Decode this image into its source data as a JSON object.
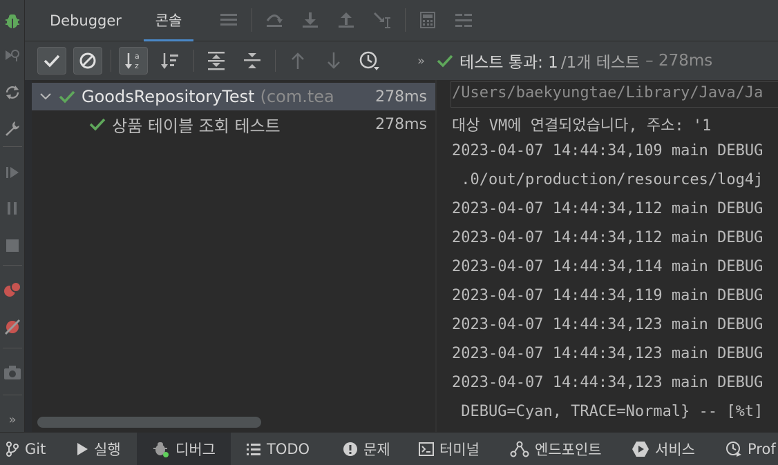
{
  "top_tabs": {
    "debugger": "Debugger",
    "console": "콘솔"
  },
  "test_status": {
    "label": "테스트 통과: 1",
    "suffix": "/1개 테스트",
    "duration": "– 278ms"
  },
  "tree": {
    "root": {
      "name": "GoodsRepositoryTest",
      "package": "(com.tea",
      "time": "278ms"
    },
    "child": {
      "name": "상품 테이블 조회 테스트",
      "time": "278ms"
    }
  },
  "console_lines": [
    "/Users/baekyungtae/Library/Java/Ja",
    "대상 VM에 연결되었습니다, 주소: '1",
    "2023-04-07 14:44:34,109 main DEBUG",
    " .0/out/production/resources/log4j",
    "2023-04-07 14:44:34,112 main DEBUG",
    "2023-04-07 14:44:34,112 main DEBUG",
    "2023-04-07 14:44:34,114 main DEBUG",
    "2023-04-07 14:44:34,119 main DEBUG",
    "2023-04-07 14:44:34,123 main DEBUG",
    "2023-04-07 14:44:34,123 main DEBUG",
    "2023-04-07 14:44:34,123 main DEBUG",
    " DEBUG=Cyan, TRACE=Normal} -- [%t]"
  ],
  "bottom_bar": {
    "git": "Git",
    "run": "실행",
    "debug": "디버그",
    "todo": "TODO",
    "problems": "문제",
    "terminal": "터미널",
    "endpoints": "엔드포인트",
    "services": "서비스",
    "profiler": "Prof"
  },
  "colors": {
    "pass_green": "#5fa85b",
    "accent_blue": "#4a88c7",
    "stop_red": "#c75450"
  }
}
